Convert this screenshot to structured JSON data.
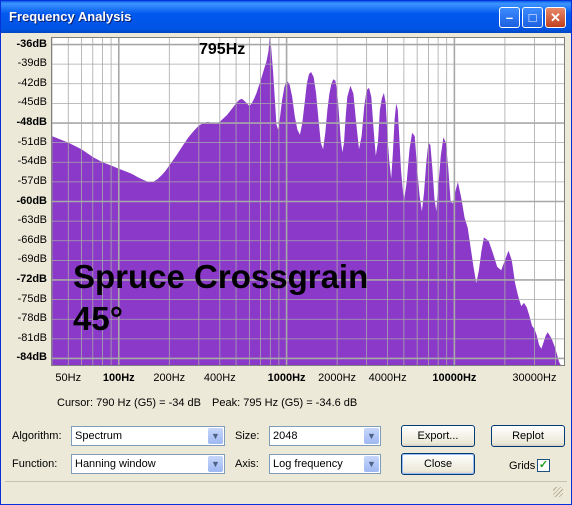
{
  "window": {
    "title": "Frequency Analysis"
  },
  "title_buttons": {
    "minimize": "–",
    "maximize": "□",
    "close": "✕"
  },
  "chart_data": {
    "type": "area",
    "x_scale": "log",
    "xlim": [
      40,
      45000
    ],
    "ylim": [
      -85,
      -35
    ],
    "y_ticks": [
      "-36dB",
      "-39dB",
      "-42dB",
      "-45dB",
      "-48dB",
      "-51dB",
      "-54dB",
      "-57dB",
      "-60dB",
      "-63dB",
      "-66dB",
      "-69dB",
      "-72dB",
      "-75dB",
      "-78dB",
      "-81dB",
      "-84dB"
    ],
    "y_tick_values": [
      -36,
      -39,
      -42,
      -45,
      -48,
      -51,
      -54,
      -57,
      -60,
      -63,
      -66,
      -69,
      -72,
      -75,
      -78,
      -81,
      -84
    ],
    "y_bold": [
      -36,
      -48,
      -60,
      -72,
      -84
    ],
    "x_ticks": [
      "50Hz",
      "100Hz",
      "200Hz",
      "400Hz",
      "1000Hz",
      "2000Hz",
      "4000Hz",
      "10000Hz",
      "30000Hz"
    ],
    "x_tick_values": [
      50,
      100,
      200,
      400,
      1000,
      2000,
      4000,
      10000,
      30000
    ],
    "x_bold": [
      100,
      1000,
      10000
    ],
    "peak_annotation": "795Hz",
    "grid": true,
    "color": "#8b39c8",
    "x": [
      40,
      50,
      60,
      70,
      80,
      90,
      100,
      110,
      120,
      130,
      140,
      150,
      160,
      170,
      180,
      190,
      200,
      220,
      240,
      260,
      280,
      300,
      320,
      340,
      360,
      380,
      400,
      420,
      440,
      460,
      480,
      500,
      520,
      540,
      560,
      580,
      600,
      620,
      640,
      660,
      680,
      700,
      720,
      740,
      760,
      780,
      795,
      810,
      830,
      850,
      870,
      890,
      910,
      940,
      970,
      1000,
      1040,
      1080,
      1120,
      1160,
      1200,
      1240,
      1280,
      1320,
      1360,
      1400,
      1450,
      1500,
      1550,
      1600,
      1650,
      1700,
      1750,
      1800,
      1850,
      1900,
      1950,
      2000,
      2050,
      2100,
      2150,
      2200,
      2250,
      2300,
      2400,
      2500,
      2600,
      2700,
      2800,
      2900,
      3000,
      3100,
      3200,
      3300,
      3400,
      3500,
      3600,
      3700,
      3800,
      3900,
      4000,
      4100,
      4200,
      4300,
      4400,
      4500,
      4600,
      4700,
      4800,
      4900,
      5000,
      5200,
      5400,
      5600,
      5800,
      6000,
      6200,
      6400,
      6600,
      6800,
      7000,
      7200,
      7400,
      7600,
      7800,
      8000,
      8300,
      8600,
      8900,
      9200,
      9500,
      9800,
      10000,
      10500,
      11000,
      11500,
      12000,
      12500,
      13000,
      13500,
      14000,
      14500,
      15000,
      16000,
      17000,
      18000,
      19000,
      20000,
      21000,
      22000,
      23000,
      24000,
      25000,
      26000,
      27000,
      28000,
      29000,
      30000,
      31000,
      32000,
      33000,
      34000,
      35000,
      36000,
      38000,
      40000,
      42000,
      45000
    ],
    "y": [
      -50,
      -51,
      -52,
      -53.2,
      -54,
      -54.5,
      -55,
      -55.4,
      -55.8,
      -56.3,
      -56.7,
      -57,
      -57,
      -56.6,
      -56,
      -55.3,
      -54.5,
      -53,
      -51.5,
      -50.2,
      -49.2,
      -48.4,
      -48,
      -47.8,
      -48,
      -48.1,
      -47.8,
      -47.3,
      -46.8,
      -46.2,
      -45.6,
      -45,
      -44.5,
      -44.3,
      -44.6,
      -45,
      -45.4,
      -45,
      -44.3,
      -43.5,
      -42.5,
      -41.5,
      -40.5,
      -39.5,
      -38.5,
      -37,
      -34.6,
      -36.5,
      -40,
      -44,
      -48.2,
      -49,
      -47.5,
      -44.5,
      -42.5,
      -41.5,
      -42,
      -44,
      -47,
      -49,
      -49.8,
      -48,
      -45,
      -42,
      -40.5,
      -40.2,
      -41,
      -43.5,
      -47.5,
      -51,
      -52,
      -49.5,
      -46,
      -43.5,
      -42,
      -41.3,
      -41.5,
      -43,
      -46.5,
      -50.5,
      -52.5,
      -51,
      -47,
      -44,
      -42.3,
      -43.5,
      -48,
      -52,
      -50,
      -45.5,
      -43,
      -42.6,
      -44,
      -49,
      -53,
      -51,
      -46,
      -44.2,
      -43.4,
      -45,
      -50.5,
      -54,
      -56.5,
      -52.5,
      -47.5,
      -45,
      -46,
      -50.5,
      -55,
      -57.5,
      -60,
      -57,
      -52,
      -49.5,
      -50,
      -55,
      -59,
      -61.5,
      -58.5,
      -54,
      -51,
      -51.4,
      -55,
      -59.5,
      -61.5,
      -58,
      -53,
      -50.2,
      -51,
      -55,
      -60,
      -60.3,
      -59,
      -57,
      -59.5,
      -62.5,
      -64,
      -67,
      -70,
      -72.5,
      -70.5,
      -67.5,
      -65.5,
      -66,
      -68,
      -70,
      -70.5,
      -69,
      -67.5,
      -69,
      -72.5,
      -74.5,
      -76,
      -75.5,
      -76.2,
      -77.5,
      -79,
      -79.5,
      -80.5,
      -82,
      -82.5,
      -81.5,
      -80.5,
      -80,
      -81,
      -82.5,
      -84.5,
      -86
    ]
  },
  "overlay_text": {
    "line1": "Spruce Crossgrain",
    "line2": "45°"
  },
  "status": {
    "cursor": "Cursor: 790 Hz (G5) = -34 dB",
    "peak": "Peak: 795 Hz (G5) = -34.6 dB"
  },
  "controls": {
    "algorithm_label": "Algorithm:",
    "algorithm_value": "Spectrum",
    "function_label": "Function:",
    "function_value": "Hanning window",
    "size_label": "Size:",
    "size_value": "2048",
    "axis_label": "Axis:",
    "axis_value": "Log frequency",
    "export_label": "Export...",
    "replot_label": "Replot",
    "close_label": "Close",
    "grids_label": "Grids",
    "grids_checked": "✓"
  }
}
